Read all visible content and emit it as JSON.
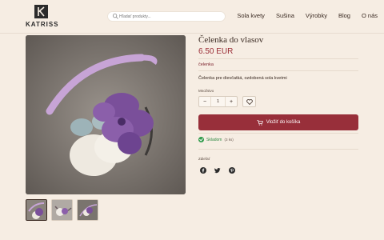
{
  "header": {
    "logo_text": "KATRISS",
    "search": {
      "placeholder": "Hľadať produkty..."
    },
    "nav": [
      "Sola kvety",
      "Sušina",
      "Výrobky",
      "Blog",
      "O nás"
    ]
  },
  "product": {
    "title": "Čelenka do vlasov",
    "price": "6.50 EUR",
    "category": "čelenka",
    "description": "Čelenka pre dievčatká, ozdobená sola kvetmi",
    "quantity_label": "Množstvo",
    "quantity": "1",
    "decrement": "−",
    "increment": "+",
    "add_to_cart": "Vložiť do košíka",
    "stock_status": "Skladom",
    "stock_count": "(3 ks)",
    "share_label": "Zdieľať"
  },
  "icons": {
    "search": "search-icon",
    "heart": "heart-icon",
    "cart": "cart-icon",
    "stock": "check-circle-icon",
    "share": [
      "facebook-icon",
      "twitter-icon",
      "pinterest-icon"
    ]
  },
  "colors": {
    "background": "#f6ede3",
    "accent": "#982f3a",
    "price": "#9a2c35",
    "stock": "#2f9a4a"
  },
  "gallery": {
    "thumbnail_count": 3,
    "active_index": 0
  }
}
